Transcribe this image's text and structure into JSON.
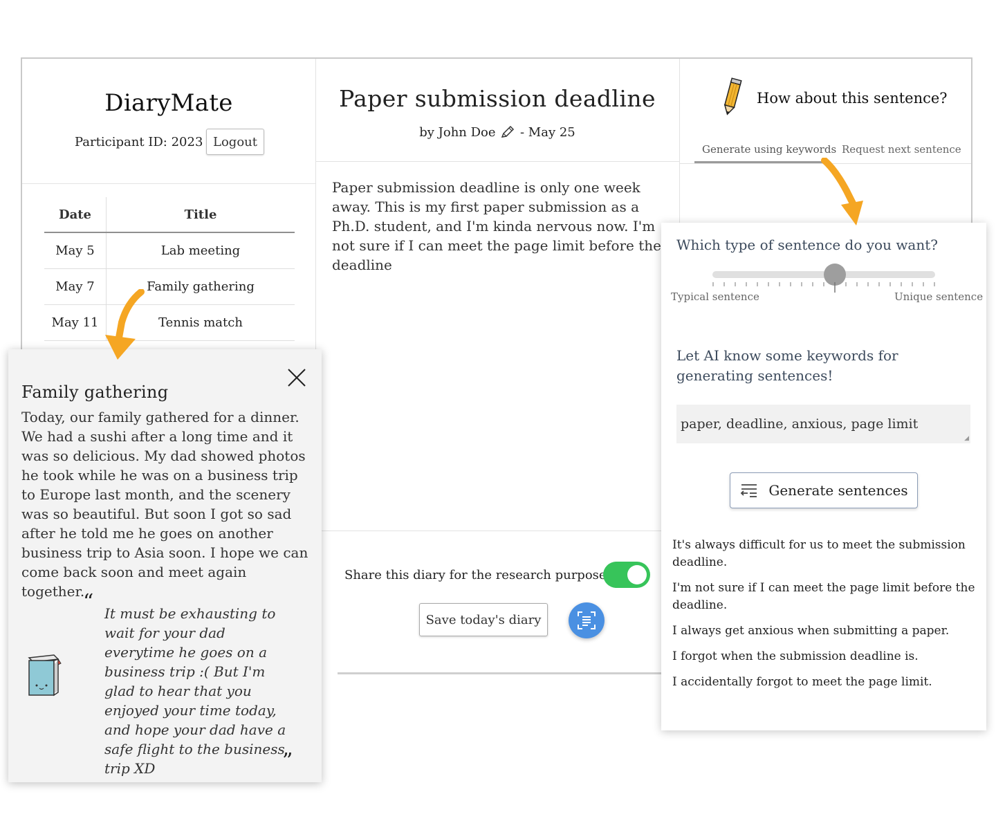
{
  "app": {
    "name": "DiaryMate",
    "participant_label": "Participant ID: 2023",
    "logout_label": "Logout"
  },
  "diary_list": {
    "headers": {
      "date": "Date",
      "title": "Title"
    },
    "rows": [
      {
        "date": "May 5",
        "title": "Lab meeting"
      },
      {
        "date": "May 7",
        "title": "Family gathering"
      },
      {
        "date": "May 11",
        "title": "Tennis match"
      }
    ]
  },
  "entry": {
    "title": "Paper submission deadline",
    "byline_prefix": "by John Doe",
    "byline_suffix": "- May 25",
    "text": "Paper submission deadline is only one week away. This is my first paper submission as a Ph.D. student, and I'm kinda nervous now. I'm not sure if I can meet the page limit before the deadline",
    "share_label": "Share this diary for the research purposes",
    "share_enabled": true,
    "save_label": "Save today's diary"
  },
  "assistant": {
    "heading": "How about this sentence?",
    "tabs": [
      "Generate using keywords",
      "Request next sentence"
    ],
    "active_tab": 0,
    "slider_question": "Which type of sentence do you want?",
    "slider_min_label": "Typical sentence",
    "slider_max_label": "Unique sentence",
    "slider_value": 0.55,
    "keywords_prompt": "Let AI know some keywords for generating sentences!",
    "keywords_value": "paper, deadline, anxious, page limit",
    "generate_label": "Generate sentences",
    "suggestions": [
      "It's always difficult for us to meet the submission deadline.",
      "I'm not sure if I can meet the page limit before the deadline.",
      "I always get anxious when submitting a paper.",
      "I forgot when the submission deadline is.",
      "I accidentally forgot to meet the page limit."
    ]
  },
  "past_entry_card": {
    "close_label": "X",
    "title": "Family gathering",
    "body": "Today, our family gathered for a dinner. We had a sushi after a long time and it was so delicious. My dad showed photos he took while he was on a business trip to Europe last month, and the scenery was so beautiful. But soon I got so sad after he told me he goes on another business trip to Asia soon. I hope we can come back soon and meet again together.",
    "quote_open": "“",
    "quote_close": "”",
    "comment": "It must be exhausting to wait for your dad everytime he goes on a business trip :( But I'm glad to hear that you enjoyed your time today, and hope your dad have a safe flight to the business trip XD"
  },
  "colors": {
    "toggle_on": "#37c45a",
    "scan_button": "#4a90e2",
    "arrow": "#f5a623",
    "book": "#8fc9d6"
  },
  "icons": [
    "pencil-icon",
    "scan-icon",
    "generate-list-icon",
    "close-icon",
    "book-mascot-icon",
    "arrow-icon"
  ]
}
